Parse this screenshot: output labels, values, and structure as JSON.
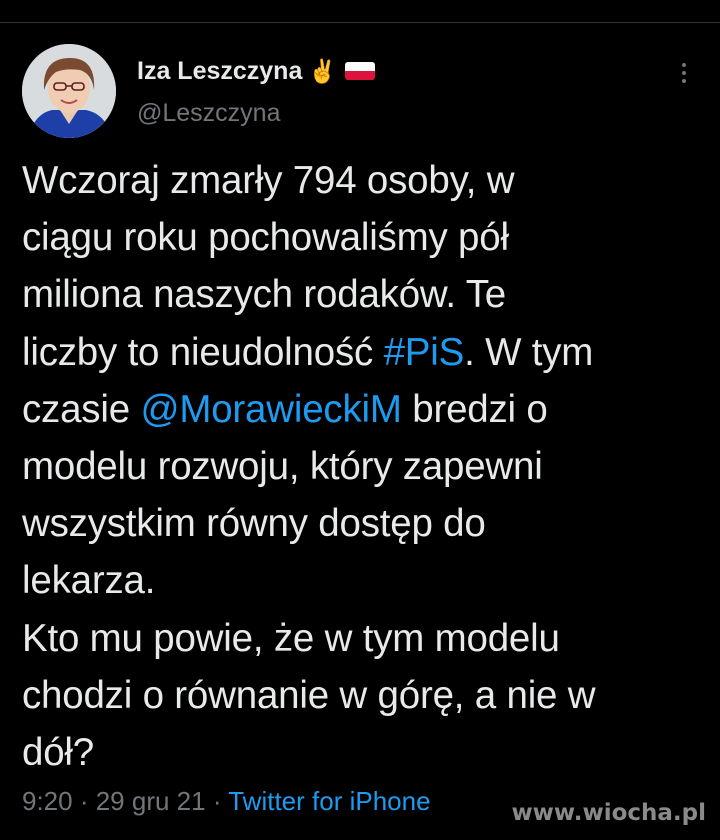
{
  "author": {
    "display_name": "Iza Leszczyna",
    "name_emoji": "✌️",
    "flag_icon": "poland-flag-icon",
    "handle": "@Leszczyna",
    "avatar_icon": "profile-photo"
  },
  "menu": {
    "more_icon": "more-vertical-icon"
  },
  "tweet": {
    "lines": [
      [
        {
          "t": "Wczoraj zmarły 794 osoby, w"
        }
      ],
      [
        {
          "t": "ciągu roku pochowaliśmy pół"
        }
      ],
      [
        {
          "t": "miliona naszych rodaków. Te"
        }
      ],
      [
        {
          "t": "liczby to nieudolność "
        },
        {
          "t": "#PiS",
          "link": true
        },
        {
          "t": ". W tym"
        }
      ],
      [
        {
          "t": "czasie "
        },
        {
          "t": "@MorawieckiM",
          "link": true
        },
        {
          "t": " bredzi o"
        }
      ],
      [
        {
          "t": "modelu rozwoju, który zapewni"
        }
      ],
      [
        {
          "t": "wszystkim równy dostęp do"
        }
      ],
      [
        {
          "t": "lekarza."
        }
      ],
      [
        {
          "t": "Kto mu powie, że w tym modelu"
        }
      ],
      [
        {
          "t": "chodzi o równanie w górę, a nie w"
        }
      ],
      [
        {
          "t": "dół?"
        }
      ]
    ]
  },
  "meta": {
    "time": "9:20",
    "separator": " · ",
    "date": "29 gru 21",
    "source": "Twitter for iPhone"
  },
  "watermark": "www.wiocha.pl",
  "colors": {
    "background": "#000000",
    "text": "#e7e9ea",
    "secondary": "#71767b",
    "link": "#1d9bf0"
  }
}
